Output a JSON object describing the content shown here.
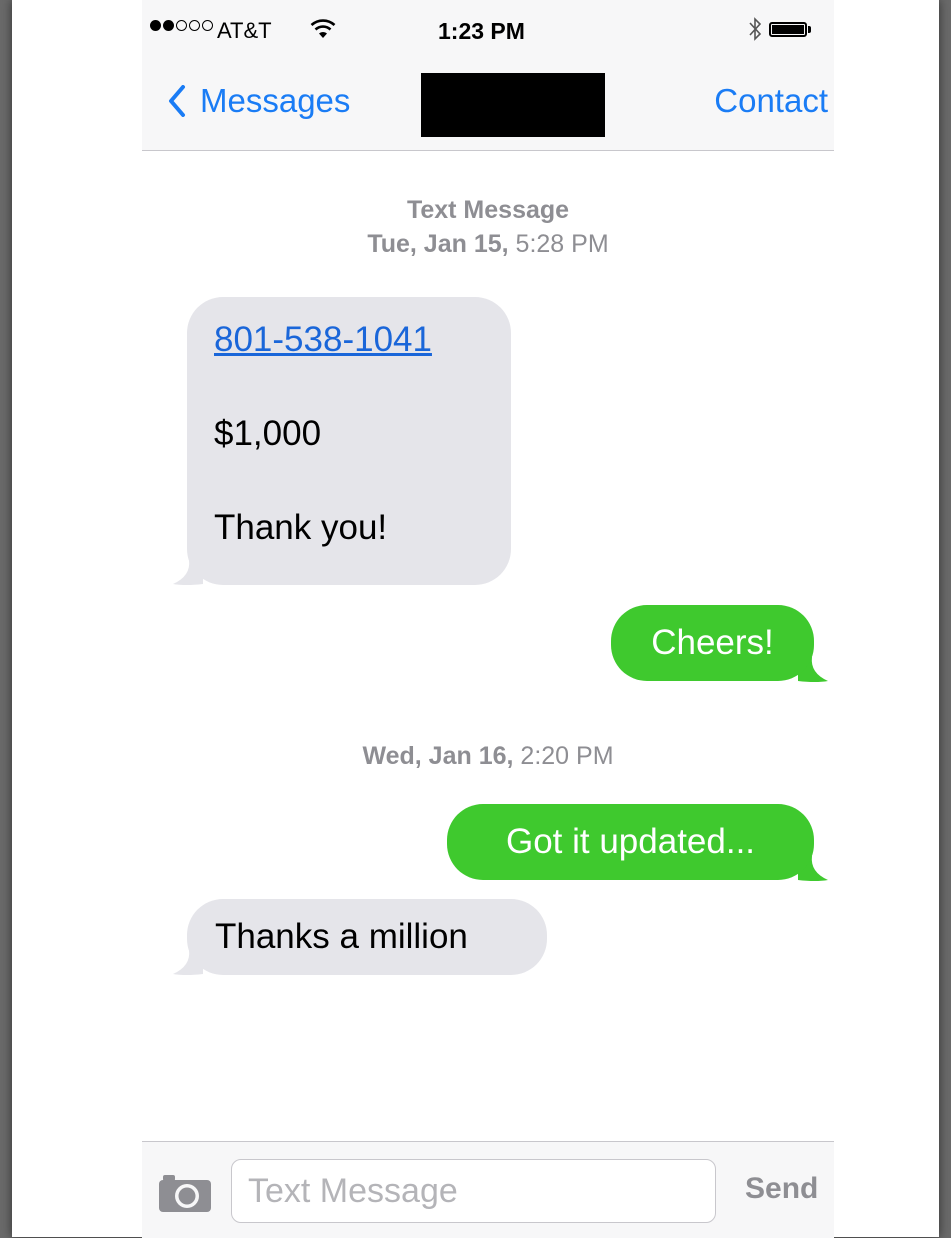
{
  "status_bar": {
    "carrier": "AT&T",
    "time": "1:23 PM",
    "signal_bars_filled": 2,
    "signal_bars_total": 5,
    "battery_level": 1.0
  },
  "nav": {
    "back_label": "Messages",
    "contact_label": "Contact"
  },
  "conversation": {
    "header_type": "Text Message",
    "stamp1_day": "Tue, Jan 15,",
    "stamp1_time": "5:28 PM",
    "stamp2_day": "Wed, Jan 16,",
    "stamp2_time": "2:20 PM",
    "messages": [
      {
        "direction": "incoming",
        "link": "801-538-1041",
        "line2": "$1,000",
        "line3": "Thank you!"
      },
      {
        "direction": "outgoing",
        "text": "Cheers!"
      },
      {
        "direction": "outgoing",
        "text": "Got it updated..."
      },
      {
        "direction": "incoming",
        "text": "Thanks a million"
      }
    ]
  },
  "input_bar": {
    "placeholder": "Text Message",
    "send_label": "Send"
  },
  "colors": {
    "ios_blue": "#1a7cf5",
    "sms_green": "#3fc92e",
    "incoming_gray": "#e5e5ea",
    "meta_gray": "#8e8e93"
  },
  "icons": [
    "wifi-icon",
    "bluetooth-icon",
    "battery-icon",
    "back-chevron-icon",
    "camera-icon"
  ]
}
